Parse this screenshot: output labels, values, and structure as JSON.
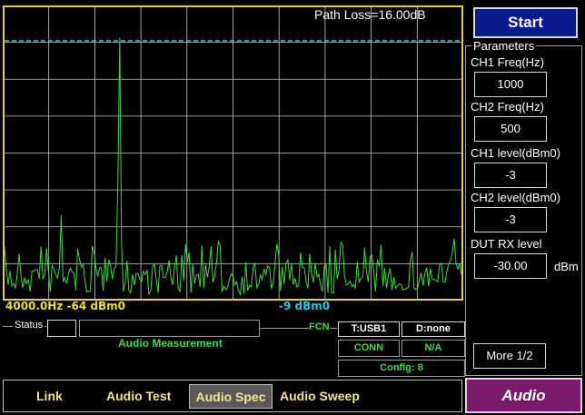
{
  "plot": {
    "title": "Path Loss=16.00dB",
    "marker_left": "4000.0Hz -64 dBm0",
    "marker_right": "-9 dBm0",
    "reference_line_level": 0.88,
    "colors": {
      "trace": "#33dd33",
      "grid": "#c8c8c8",
      "border": "#e0d040",
      "reference": "#22c8e8"
    }
  },
  "status": {
    "label": "Status",
    "measurement": "Audio Measurement",
    "fcn_label": "FCN",
    "cells": [
      "T:USB1",
      "D:none",
      "CONN",
      "N/A"
    ],
    "config": "Config: 8"
  },
  "panel": {
    "start_label": "Start",
    "parameters_title": "Parameters",
    "fields": [
      {
        "label": "CH1 Freq(Hz)",
        "value": "1000"
      },
      {
        "label": "CH2 Freq(Hz)",
        "value": "500"
      },
      {
        "label": "CH1 level(dBm0)",
        "value": "-3"
      },
      {
        "label": "CH2 level(dBm0)",
        "value": "-3"
      },
      {
        "label": "DUT RX level",
        "value": "-30.00",
        "unit": "dBm"
      }
    ],
    "more_label": "More 1/2"
  },
  "nav": {
    "tabs": [
      "Link",
      "Audio Test",
      "Audio Spec",
      "Audio Sweep"
    ],
    "active_tab": "Audio Spec",
    "mode_label": "Audio"
  }
}
